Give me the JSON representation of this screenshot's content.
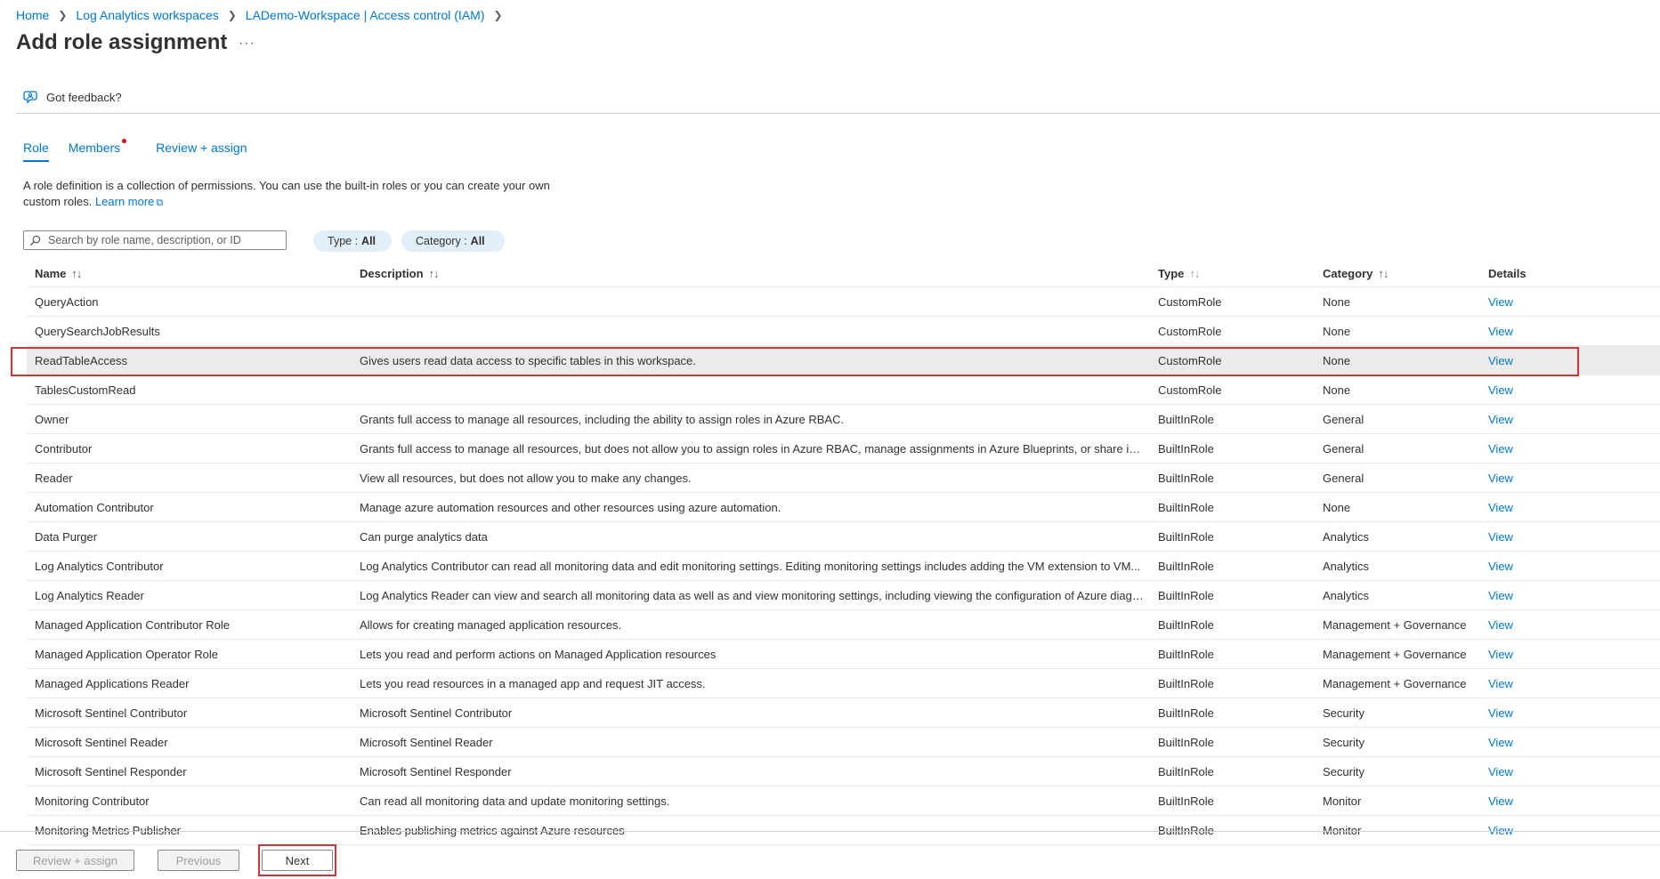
{
  "breadcrumb": {
    "items": [
      "Home",
      "Log Analytics workspaces",
      "LADemo-Workspace | Access control (IAM)"
    ]
  },
  "page": {
    "title": "Add role assignment",
    "more": "···"
  },
  "feedback": {
    "label": "Got feedback?"
  },
  "tabs": [
    {
      "label": "Role",
      "active": true
    },
    {
      "label": "Members",
      "dot": true
    },
    {
      "label": "Review + assign"
    }
  ],
  "description": {
    "text": "A role definition is a collection of permissions. You can use the built-in roles or you can create your own custom roles.",
    "link": "Learn more"
  },
  "search": {
    "placeholder": "Search by role name, description, or ID"
  },
  "filters": {
    "type": {
      "label": "Type :",
      "value": "All"
    },
    "category": {
      "label": "Category :",
      "value": "All"
    }
  },
  "table": {
    "headers": {
      "name": "Name",
      "description": "Description",
      "type": "Type",
      "category": "Category",
      "details": "Details"
    },
    "sort_glyph": "↑↓",
    "rows": [
      {
        "name": "QueryAction",
        "description": "",
        "type": "CustomRole",
        "category": "None",
        "details": "View"
      },
      {
        "name": "QuerySearchJobResults",
        "description": "",
        "type": "CustomRole",
        "category": "None",
        "details": "View"
      },
      {
        "name": "ReadTableAccess",
        "description": "Gives users read data access to specific tables in this workspace.",
        "type": "CustomRole",
        "category": "None",
        "details": "View",
        "selected": true
      },
      {
        "name": "TablesCustomRead",
        "description": "",
        "type": "CustomRole",
        "category": "None",
        "details": "View"
      },
      {
        "name": "Owner",
        "description": "Grants full access to manage all resources, including the ability to assign roles in Azure RBAC.",
        "type": "BuiltInRole",
        "category": "General",
        "details": "View"
      },
      {
        "name": "Contributor",
        "description": "Grants full access to manage all resources, but does not allow you to assign roles in Azure RBAC, manage assignments in Azure Blueprints, or share image...",
        "type": "BuiltInRole",
        "category": "General",
        "details": "View"
      },
      {
        "name": "Reader",
        "description": "View all resources, but does not allow you to make any changes.",
        "type": "BuiltInRole",
        "category": "General",
        "details": "View"
      },
      {
        "name": "Automation Contributor",
        "description": "Manage azure automation resources and other resources using azure automation.",
        "type": "BuiltInRole",
        "category": "None",
        "details": "View"
      },
      {
        "name": "Data Purger",
        "description": "Can purge analytics data",
        "type": "BuiltInRole",
        "category": "Analytics",
        "details": "View"
      },
      {
        "name": "Log Analytics Contributor",
        "description": "Log Analytics Contributor can read all monitoring data and edit monitoring settings. Editing monitoring settings includes adding the VM extension to VM...",
        "type": "BuiltInRole",
        "category": "Analytics",
        "details": "View"
      },
      {
        "name": "Log Analytics Reader",
        "description": "Log Analytics Reader can view and search all monitoring data as well as and view monitoring settings, including viewing the configuration of Azure diagno...",
        "type": "BuiltInRole",
        "category": "Analytics",
        "details": "View"
      },
      {
        "name": "Managed Application Contributor Role",
        "description": "Allows for creating managed application resources.",
        "type": "BuiltInRole",
        "category": "Management + Governance",
        "details": "View"
      },
      {
        "name": "Managed Application Operator Role",
        "description": "Lets you read and perform actions on Managed Application resources",
        "type": "BuiltInRole",
        "category": "Management + Governance",
        "details": "View"
      },
      {
        "name": "Managed Applications Reader",
        "description": "Lets you read resources in a managed app and request JIT access.",
        "type": "BuiltInRole",
        "category": "Management + Governance",
        "details": "View"
      },
      {
        "name": "Microsoft Sentinel Contributor",
        "description": "Microsoft Sentinel Contributor",
        "type": "BuiltInRole",
        "category": "Security",
        "details": "View"
      },
      {
        "name": "Microsoft Sentinel Reader",
        "description": "Microsoft Sentinel Reader",
        "type": "BuiltInRole",
        "category": "Security",
        "details": "View"
      },
      {
        "name": "Microsoft Sentinel Responder",
        "description": "Microsoft Sentinel Responder",
        "type": "BuiltInRole",
        "category": "Security",
        "details": "View"
      },
      {
        "name": "Monitoring Contributor",
        "description": "Can read all monitoring data and update monitoring settings.",
        "type": "BuiltInRole",
        "category": "Monitor",
        "details": "View"
      },
      {
        "name": "Monitoring Metrics Publisher",
        "description": "Enables publishing metrics against Azure resources",
        "type": "BuiltInRole",
        "category": "Monitor",
        "details": "View"
      }
    ]
  },
  "footer": {
    "review_assign": "Review + assign",
    "previous": "Previous",
    "next": "Next"
  },
  "colors": {
    "accent": "#0078d4",
    "highlight": "#d13438",
    "pill_bg": "#e1effa",
    "notification_dot": "#e00b1c"
  }
}
